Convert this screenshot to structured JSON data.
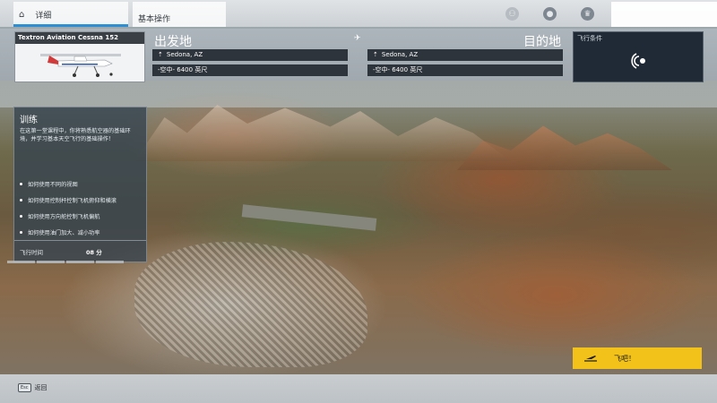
{
  "tabs": {
    "home_label": "详细",
    "basic_label": "基本操作"
  },
  "aircraft": {
    "name": "Textron Aviation Cessna 152"
  },
  "departure": {
    "title": "出发地",
    "airport": "Sedona, AZ",
    "altitude": "-空中- 6400 英尺"
  },
  "arrival": {
    "title": "目的地",
    "airport": "Sedona, AZ",
    "altitude": "-空中- 6400 英尺"
  },
  "weather": {
    "label": "飞行条件"
  },
  "training": {
    "title": "训练",
    "description": "在这第一堂课程中，你将熟悉航空器的基础环境，并学习基本天空飞行的基础操作！",
    "items": [
      "如何使用不同的视图",
      "如何使用控制杆控制飞机俯仰和横滚",
      "如何使用方向舵控制飞机偏航",
      "如何使用油门加大、减小功率"
    ],
    "time_label": "飞行时间",
    "time_value": "08 分"
  },
  "fly_button": {
    "label": "飞吧！"
  },
  "bottom": {
    "esc_key": "Esc",
    "back_label": "返回"
  },
  "colors": {
    "accent": "#2b8fd6",
    "fly_button": "#f2c21a",
    "panel": "#344250"
  },
  "icons": {
    "home": "home-icon",
    "group": "group-icon",
    "profile": "profile-icon",
    "achievements": "achievements-icon",
    "plane": "plane-icon",
    "pin": "location-pin-icon",
    "wind": "wind-icon",
    "fly": "takeoff-icon"
  }
}
